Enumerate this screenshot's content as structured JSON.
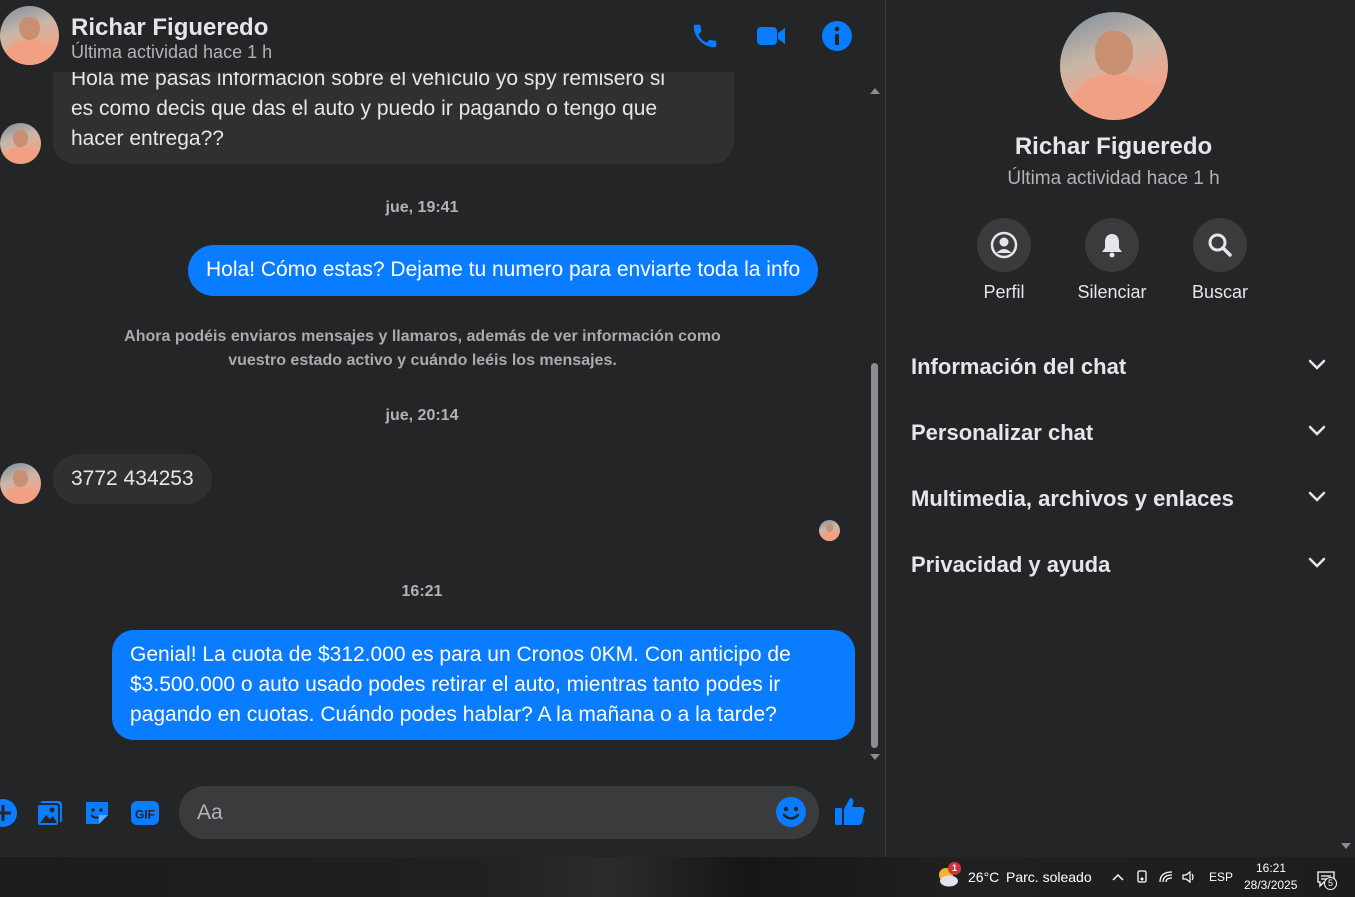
{
  "header": {
    "name": "Richar Figueredo",
    "status": "Última actividad hace 1 h",
    "icons": [
      "phone-icon",
      "video-icon",
      "info-icon"
    ]
  },
  "messages": {
    "first_incoming": {
      "partial_line": "Hola me pasas información sobre el vehículo yo spy remisero si",
      "line2": "es como decis que das el auto y puedo ir pagando o tengo que",
      "line3": "hacer entrega??"
    },
    "ts1": "jue, 19:41",
    "outgoing1": "Hola! Cómo estas? Dejame tu numero para enviarte toda la info",
    "notice_line1": "Ahora podéis enviaros mensajes y llamaros, además de ver información como",
    "notice_line2": "vuestro estado activo y cuándo leéis los mensajes.",
    "ts2": "jue, 20:14",
    "incoming2": "3772 434253",
    "ts3": "16:21",
    "outgoing2_line1": "Genial! La cuota de $312.000 es para un Cronos 0KM. Con anticipo de",
    "outgoing2_line2": "$3.500.000 o auto usado podes retirar el auto, mientras tanto podes ir",
    "outgoing2_line3": "pagando en cuotas. Cuándo podes hablar? A la mañana o a la tarde?"
  },
  "composer": {
    "placeholder": "Aa",
    "icons": [
      "plus-icon",
      "gallery-icon",
      "sticker-icon",
      "gif-icon",
      "emoji-icon",
      "like-icon"
    ],
    "gif_label": "GIF"
  },
  "panel": {
    "name": "Richar Figueredo",
    "status": "Última actividad hace 1 h",
    "actions": [
      {
        "label": "Perfil",
        "icon": "profile-icon"
      },
      {
        "label": "Silenciar",
        "icon": "bell-icon"
      },
      {
        "label": "Buscar",
        "icon": "search-icon"
      }
    ],
    "sections": [
      "Información del chat",
      "Personalizar chat",
      "Multimedia, archivos y enlaces",
      "Privacidad y ayuda"
    ]
  },
  "taskbar": {
    "weather_temp": "26°C",
    "weather_desc": "Parc. soleado",
    "weather_badge": "1",
    "language": "ESP",
    "time": "16:21",
    "date": "28/3/2025",
    "notif_count": "5"
  },
  "colors": {
    "background": "#242526",
    "incoming_bubble": "#303030",
    "outgoing_bubble": "#0a7cff",
    "accent": "#0a7cff"
  }
}
